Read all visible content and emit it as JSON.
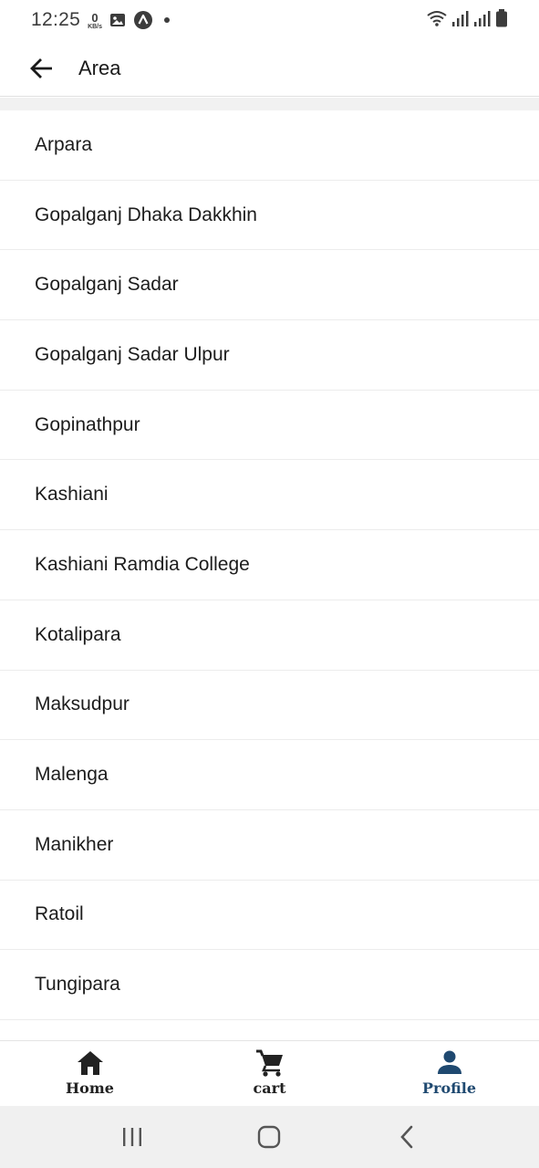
{
  "status_bar": {
    "time": "12:25",
    "net_speed_value": "0",
    "net_speed_unit": "KB/s",
    "icons": [
      "gallery-icon",
      "app-notification-icon",
      "dot-icon",
      "wifi-icon",
      "signal-icon",
      "signal-icon",
      "battery-icon"
    ]
  },
  "app_bar": {
    "back_icon": "arrow-left-icon",
    "title": "Area"
  },
  "areas": [
    "Arpara",
    "Gopalganj Dhaka Dakkhin",
    "Gopalganj Sadar",
    "Gopalganj Sadar Ulpur",
    "Gopinathpur",
    "Kashiani",
    "Kashiani Ramdia College",
    "Kotalipara",
    "Maksudpur",
    "Malenga",
    "Manikher",
    "Ratoil",
    "Tungipara"
  ],
  "bottom_nav": {
    "items": [
      {
        "label": "Home",
        "icon": "home-icon",
        "active": false
      },
      {
        "label": "cart",
        "icon": "cart-icon",
        "active": false
      },
      {
        "label": "Profile",
        "icon": "person-icon",
        "active": true
      }
    ],
    "active_color": "#1f4970",
    "inactive_color": "#222222"
  },
  "system_nav": {
    "icons": [
      "recents-icon",
      "home-circle-icon",
      "back-chevron-icon"
    ]
  }
}
